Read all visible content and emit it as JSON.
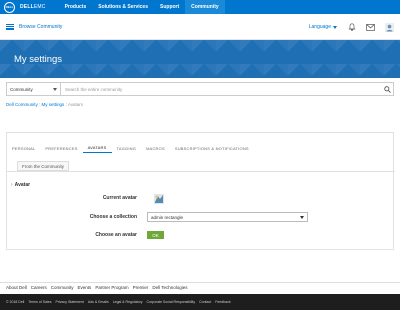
{
  "topnav": {
    "logo_text": "DELL",
    "brand_bold": "DELL",
    "brand_rest": "EMC",
    "links": [
      "Products",
      "Solutions & Services",
      "Support",
      "Community"
    ],
    "active_link": "Community"
  },
  "subheader": {
    "browse": "Browse Community",
    "language": "Language"
  },
  "hero": {
    "title": "My settings"
  },
  "search": {
    "scope": "Community",
    "placeholder": "Search the entire community"
  },
  "breadcrumb": {
    "items": [
      "Dell Community",
      "My settings",
      "Avatars"
    ]
  },
  "tabs": [
    "PERSONAL",
    "PREFERENCES",
    "AVATARS",
    "TAGGING",
    "MACROS",
    "SUBSCRIPTIONS & NOTIFICATIONS"
  ],
  "active_tab": "AVATARS",
  "subtab": "From the Community",
  "avatar_section": {
    "title": "Avatar",
    "current_avatar_label": "Current avatar",
    "collection_label": "Choose a collection",
    "collection_value": "admin rectangle",
    "choose_avatar_label": "Choose an avatar",
    "ok_button": "OK"
  },
  "footer_links": [
    "About Dell",
    "Careers",
    "Community",
    "Events",
    "Partner Program",
    "Premier",
    "Dell Technologies"
  ],
  "footer_legal": [
    "© 2018 Dell",
    "Terms of Sales",
    "Privacy Statement",
    "Ads & Emails",
    "Legal & Regulatory",
    "Corporate Social Responsibility",
    "Contact",
    "Feedback"
  ],
  "colors": {
    "brand_blue": "#0076ce",
    "ok_green": "#6ea83a"
  }
}
